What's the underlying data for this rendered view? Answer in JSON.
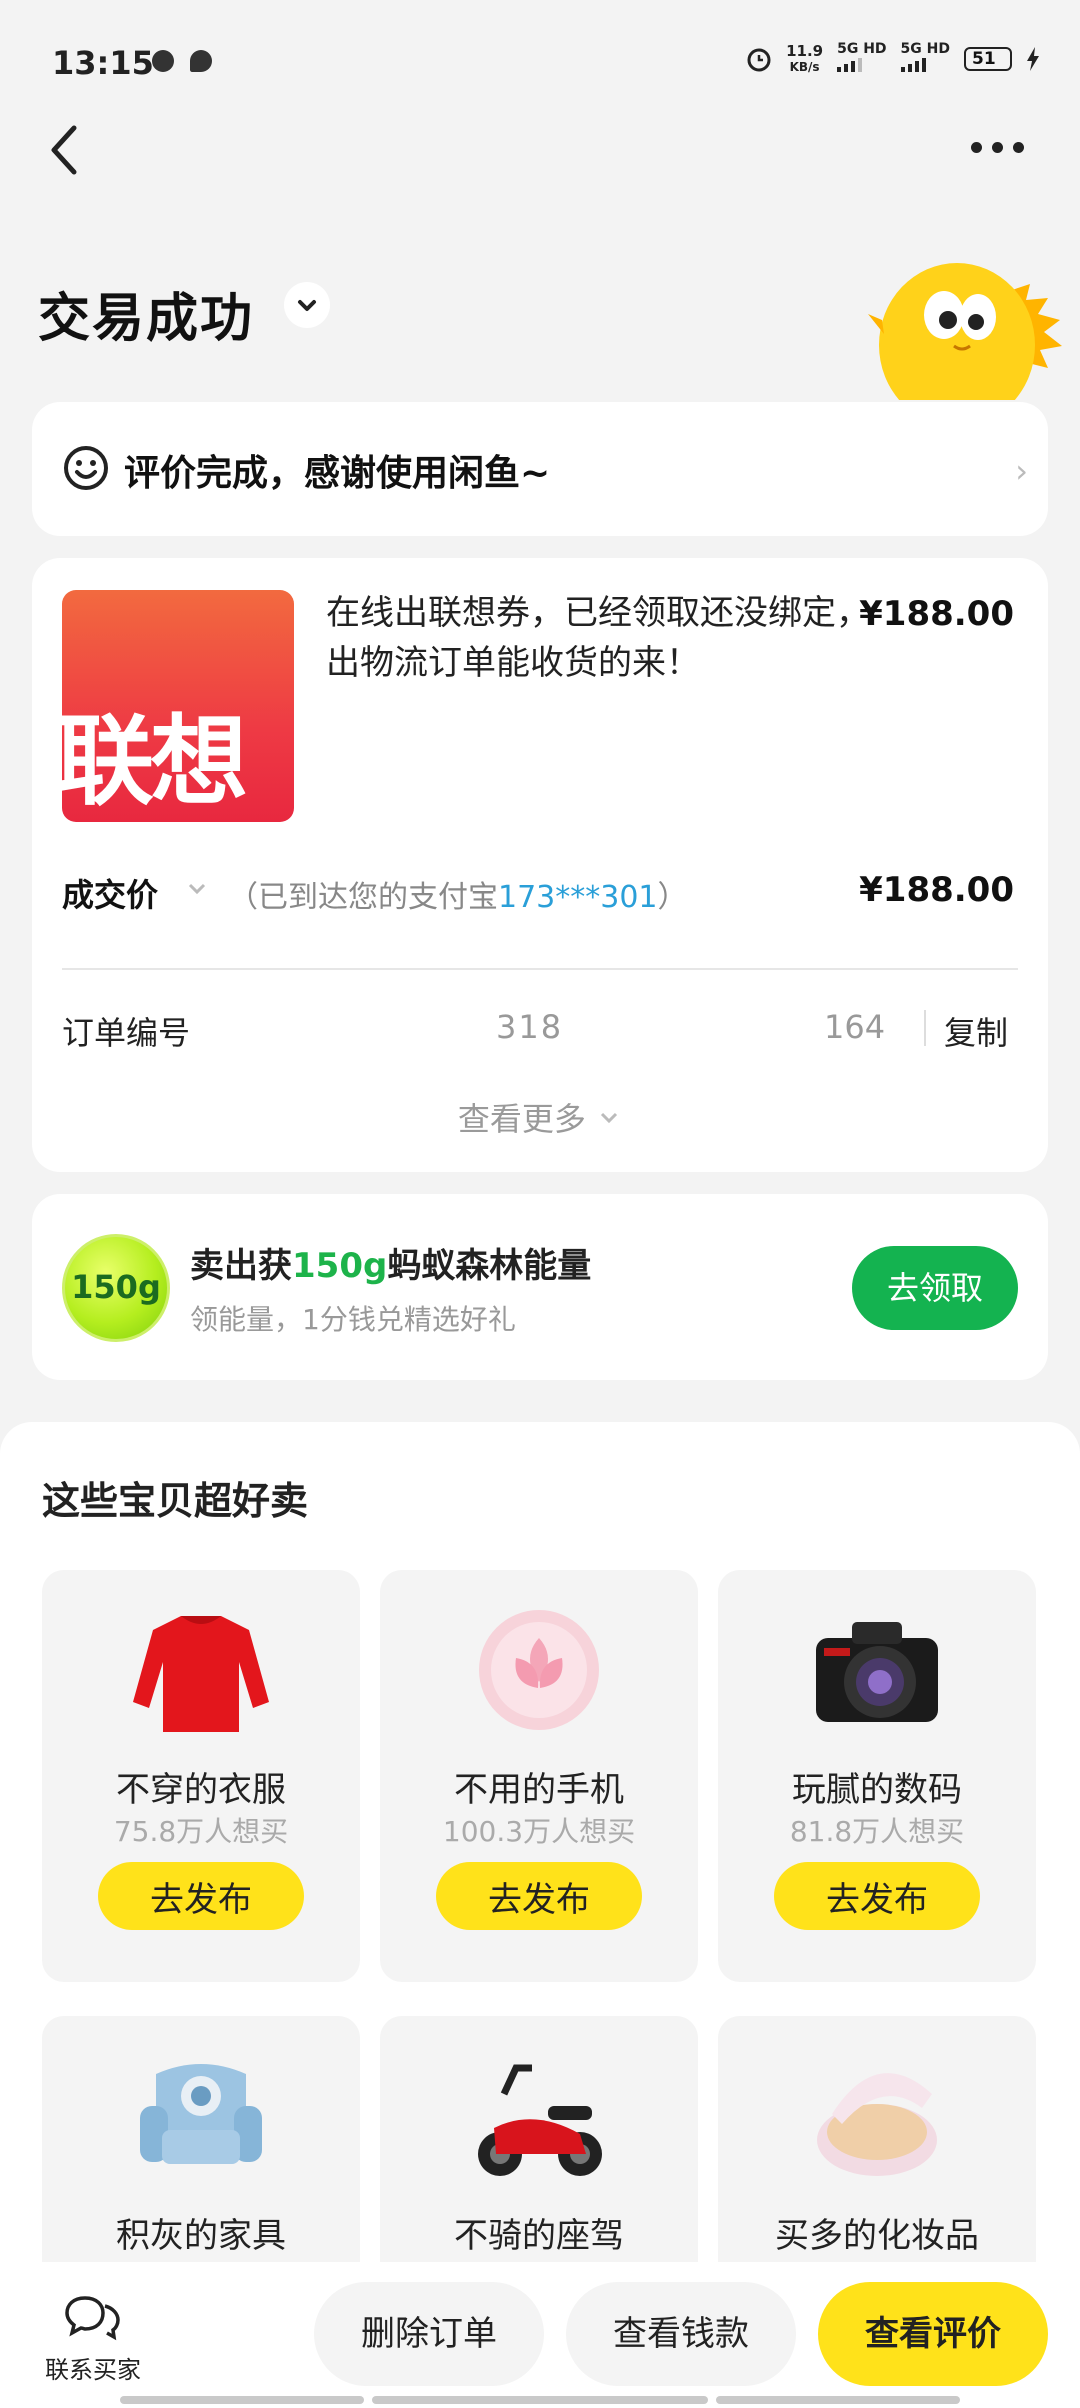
{
  "status_bar": {
    "time": "13:15",
    "net_speed": "11.9",
    "net_speed_unit": "KB/s",
    "sim1": "5G HD",
    "sim2": "5G HD",
    "battery": "51"
  },
  "header": {
    "title": "交易成功"
  },
  "rating": {
    "text": "评价完成，感谢使用闲鱼~"
  },
  "order": {
    "thumb_brand": "联想",
    "item_title": "在线出联想券，已经领取还没绑定，出物流订单能收货的来！",
    "item_price": "¥188.00",
    "deal_label": "成交价",
    "deal_note_prefix": "（已到达您的支付宝",
    "deal_note_account": "173***301",
    "deal_note_suffix": "）",
    "deal_price": "¥188.00",
    "order_no_label": "订单编号",
    "order_no_head": "318",
    "order_no_tail": "164",
    "copy_label": "复制",
    "view_more": "查看更多"
  },
  "energy": {
    "badge": "150g",
    "title_prefix": "卖出获",
    "title_highlight": "150g",
    "title_suffix": "蚂蚁森林能量",
    "subtitle": "领能量，1分钱兑精选好礼",
    "button": "去领取",
    "colors": {
      "accent": "#14b350",
      "highlight": "#1db34a"
    }
  },
  "goods": {
    "title": "这些宝贝超好卖",
    "publish_label": "去发布",
    "items": [
      {
        "name": "不穿的衣服",
        "want": "75.8万人想买",
        "icon": "sweater-icon"
      },
      {
        "name": "不用的手机",
        "want": "100.3万人想买",
        "icon": "phone-icon"
      },
      {
        "name": "玩腻的数码",
        "want": "81.8万人想买",
        "icon": "camera-icon"
      },
      {
        "name": "积灰的家具",
        "icon": "armchair-icon"
      },
      {
        "name": "不骑的座驾",
        "icon": "scooter-icon"
      },
      {
        "name": "买多的化妆品",
        "icon": "cushion-compact-icon"
      }
    ]
  },
  "bottom_bar": {
    "contact_label": "联系买家",
    "delete_label": "删除订单",
    "view_payment_label": "查看钱款",
    "view_review_label": "查看评价",
    "colors": {
      "primary": "#ffe21a"
    }
  }
}
